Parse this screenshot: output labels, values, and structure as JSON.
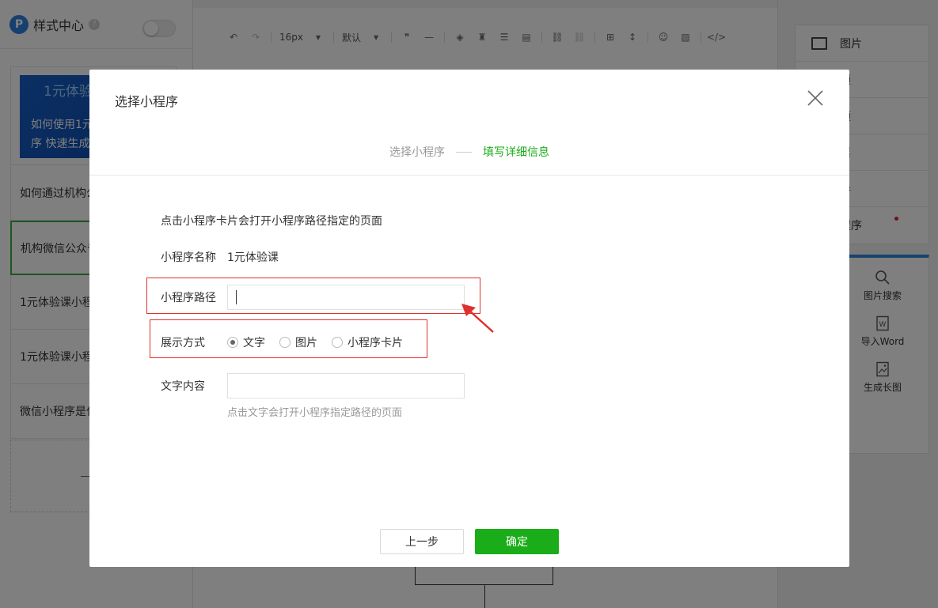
{
  "left_panel": {
    "title": "样式中心",
    "help": "?",
    "cover": {
      "top_text": "1元体验",
      "line1": "如何使用1元",
      "line2": "序 快速生成"
    },
    "items": [
      "如何通过机构公",
      "机构微信公众号",
      "1元体验课小程",
      "1元体验课小程",
      "微信小程序是什"
    ]
  },
  "toolbar": {
    "font_size": "16px",
    "font_family": "默认"
  },
  "right_panel": {
    "items": [
      "图片",
      "频",
      "频",
      "票",
      "券",
      "程序"
    ],
    "tools": [
      {
        "label": "图片搜索",
        "icon": "search-icon"
      },
      {
        "label": "导入Word",
        "icon": "word-icon"
      },
      {
        "label": "生成长图",
        "icon": "image-icon"
      }
    ]
  },
  "modal": {
    "title": "选择小程序",
    "steps": {
      "step1": "选择小程序",
      "step2": "填写详细信息"
    },
    "description": "点击小程序卡片会打开小程序路径指定的页面",
    "name_label": "小程序名称",
    "name_value": "1元体验课",
    "path_label": "小程序路径",
    "path_value": "",
    "display_label": "展示方式",
    "display_options": [
      {
        "label": "文字",
        "checked": true
      },
      {
        "label": "图片",
        "checked": false
      },
      {
        "label": "小程序卡片",
        "checked": false
      }
    ],
    "text_label": "文字内容",
    "text_value": "",
    "text_hint": "点击文字会打开小程序指定路径的页面",
    "prev_button": "上一步",
    "ok_button": "确定"
  },
  "colors": {
    "accent_green": "#1aad19",
    "highlight_red": "#e0302b",
    "overlay": "rgba(0,0,0,0.5)"
  }
}
